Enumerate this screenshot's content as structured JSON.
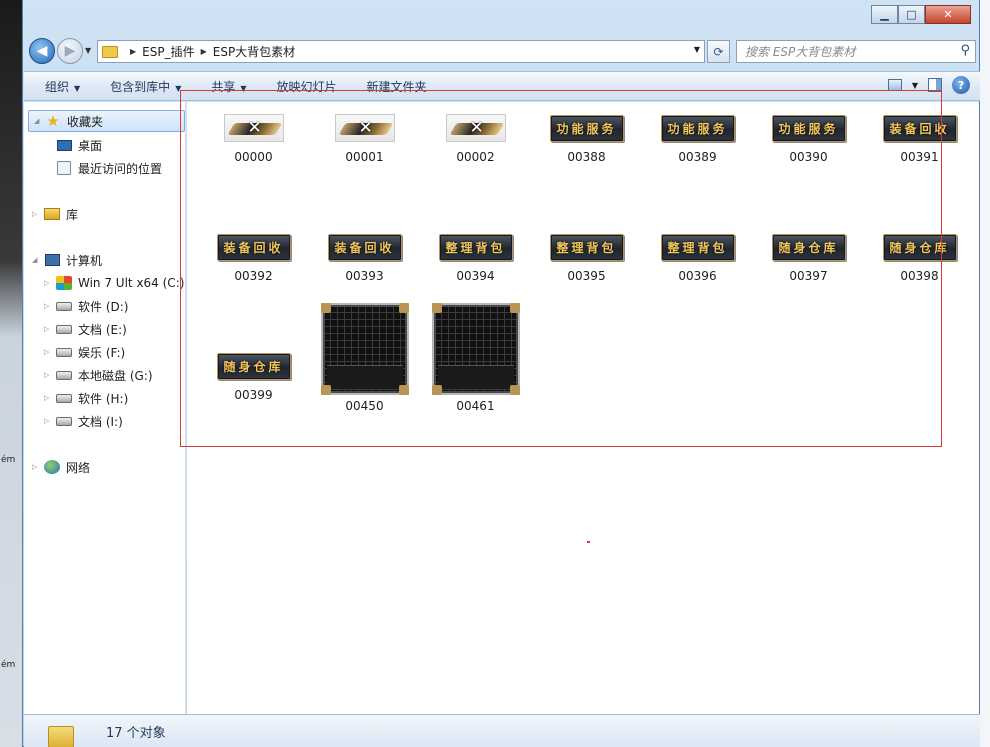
{
  "window": {
    "minimize": "▁",
    "maximize": "□",
    "close": "✕"
  },
  "address": {
    "crumbs": [
      "ESP_插件",
      "ESP大背包素材"
    ],
    "search_placeholder": "搜索 ESP大背包素材"
  },
  "toolbar": {
    "organize": "组织",
    "include_in_library": "包含到库中",
    "share": "共享",
    "slideshow": "放映幻灯片",
    "new_folder": "新建文件夹"
  },
  "nav": {
    "favorites": "收藏夹",
    "desktop": "桌面",
    "recent": "最近访问的位置",
    "libraries": "库",
    "computer": "计算机",
    "drives": [
      {
        "label": "Win 7 Ult x64 (C:)"
      },
      {
        "label": "软件 (D:)"
      },
      {
        "label": "文档 (E:)"
      },
      {
        "label": "娱乐 (F:)"
      },
      {
        "label": "本地磁盘 (G:)"
      },
      {
        "label": "软件 (H:)"
      },
      {
        "label": "文档 (I:)"
      }
    ],
    "network": "网络"
  },
  "files": [
    {
      "name": "00000",
      "kind": "logo"
    },
    {
      "name": "00001",
      "kind": "logo"
    },
    {
      "name": "00002",
      "kind": "logo"
    },
    {
      "name": "00388",
      "kind": "button",
      "text": "功能服务"
    },
    {
      "name": "00389",
      "kind": "button",
      "text": "功能服务"
    },
    {
      "name": "00390",
      "kind": "button",
      "text": "功能服务"
    },
    {
      "name": "00391",
      "kind": "button",
      "text": "装备回收"
    },
    {
      "name": "00392",
      "kind": "button",
      "text": "装备回收"
    },
    {
      "name": "00393",
      "kind": "button",
      "text": "装备回收"
    },
    {
      "name": "00394",
      "kind": "button",
      "text": "整理背包"
    },
    {
      "name": "00395",
      "kind": "button",
      "text": "整理背包"
    },
    {
      "name": "00396",
      "kind": "button",
      "text": "整理背包"
    },
    {
      "name": "00397",
      "kind": "button",
      "text": "随身仓库"
    },
    {
      "name": "00398",
      "kind": "button",
      "text": "随身仓库"
    },
    {
      "name": "00399",
      "kind": "button",
      "text": "随身仓库"
    },
    {
      "name": "00450",
      "kind": "bag"
    },
    {
      "name": "00461",
      "kind": "bag"
    }
  ],
  "status": {
    "count_text": "17 个对象"
  },
  "colors": {
    "selection_rect": "#d63a3a",
    "button_text": "#f2c65a"
  }
}
